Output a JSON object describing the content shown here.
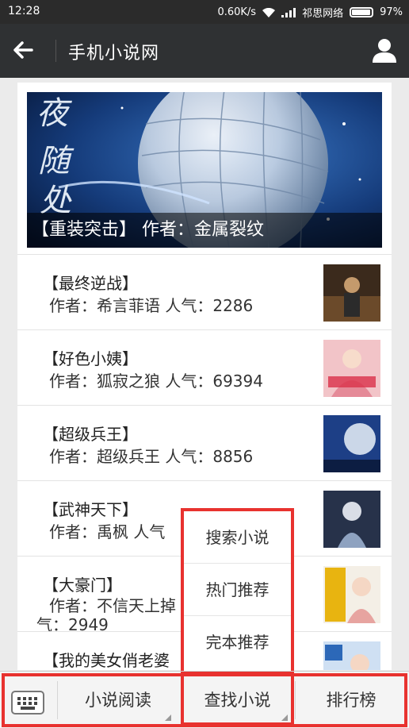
{
  "status_bar": {
    "time": "12:28",
    "net_speed": "0.60K/s",
    "carrier": "祁思网络",
    "battery": "97%",
    "battery_level": 0.97
  },
  "header": {
    "title": "手机小说网",
    "back_icon": "arrow-left-icon",
    "user_icon": "user-icon"
  },
  "banner": {
    "caption": "【重装突击】 作者：金属裂纹"
  },
  "books": [
    {
      "title": "【最终逆战】",
      "meta": "作者：希言菲语  人气：2286"
    },
    {
      "title": "【好色小姨】",
      "meta": "作者：狐寂之狼  人气：69394"
    },
    {
      "title": "【超级兵王】",
      "meta": "作者：超级兵王  人气：8856"
    },
    {
      "title": "【武神天下】",
      "meta": "作者：禹枫  人气"
    },
    {
      "title": "【大豪门】",
      "meta": "作者：不信天上掉",
      "meta2": "气：2949"
    },
    {
      "title": "【我的美女俏老婆",
      "meta": ""
    }
  ],
  "popup_menu": {
    "items": [
      "搜索小说",
      "热门推荐",
      "完本推荐"
    ]
  },
  "bottom_bar": {
    "keyboard_icon": "keyboard-icon",
    "tabs": [
      "小说阅读",
      "查找小说",
      "排行榜"
    ]
  },
  "colors": {
    "header_bg": "#2f3133",
    "highlight": "#e8322f"
  }
}
